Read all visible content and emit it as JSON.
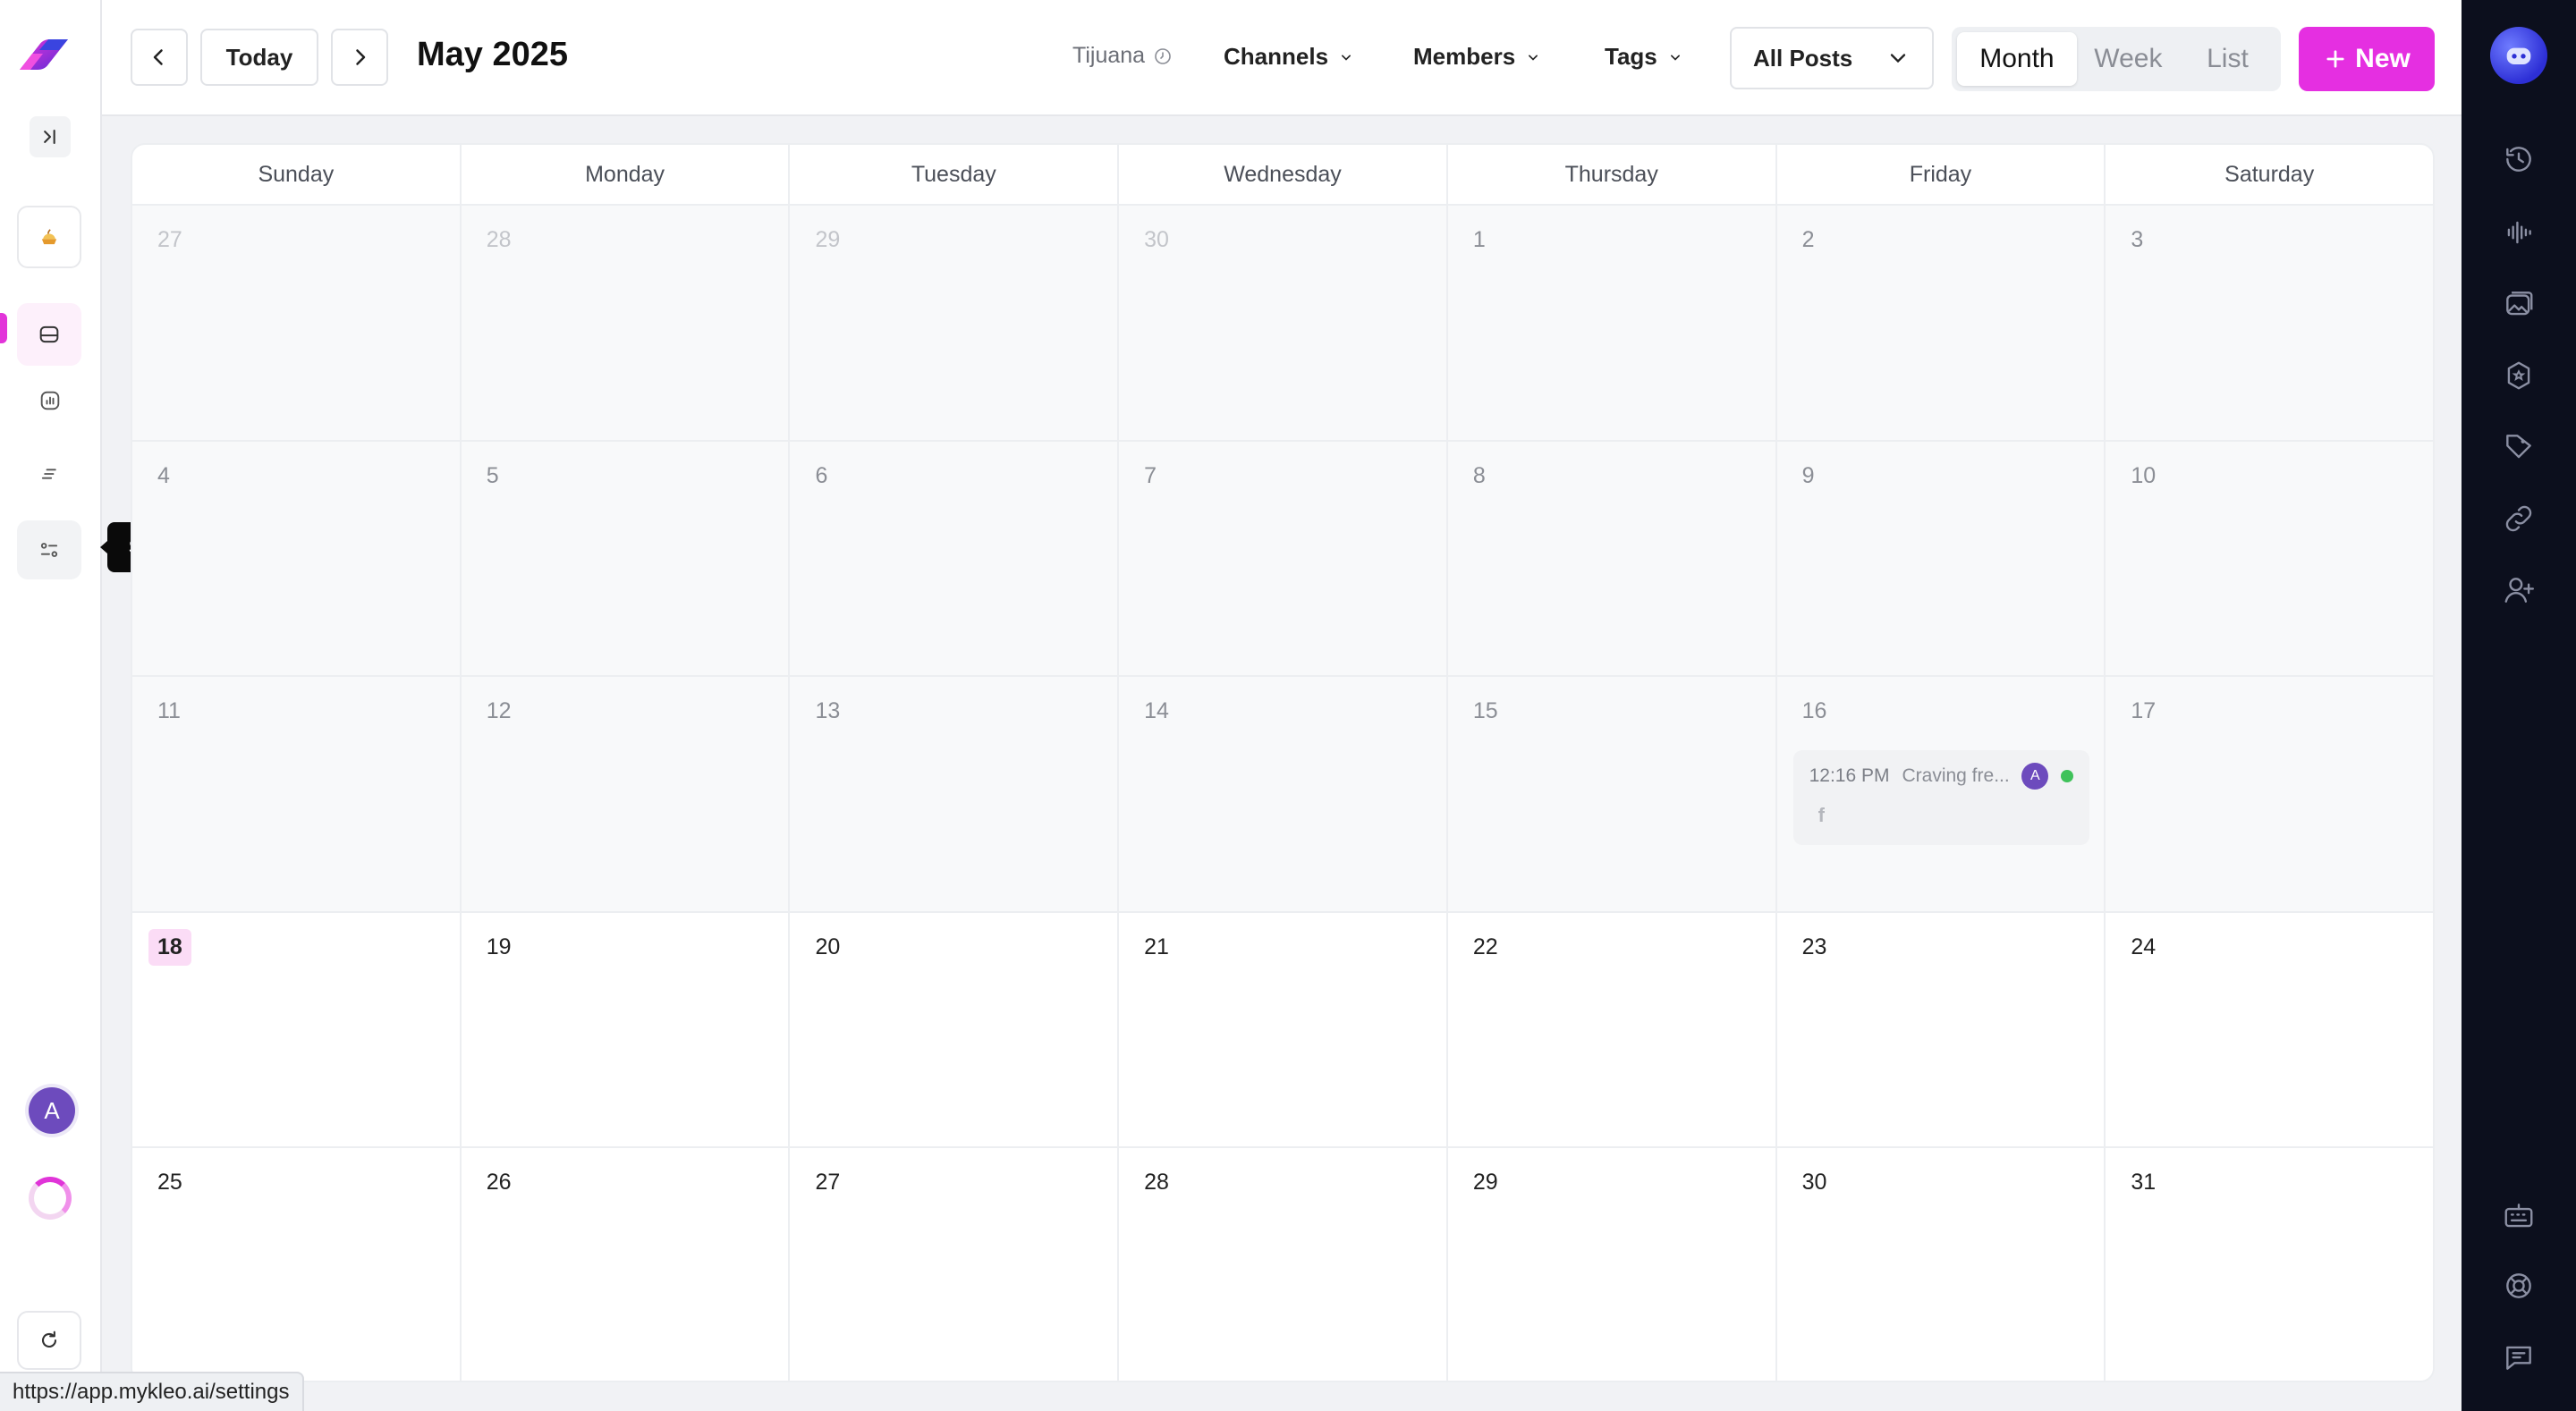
{
  "header": {
    "today_label": "Today",
    "month_title": "May 2025",
    "timezone": "Tijuana",
    "filters": {
      "channels": "Channels",
      "members": "Members",
      "tags": "Tags"
    },
    "posts_select": "All Posts",
    "views": [
      "Month",
      "Week",
      "List"
    ],
    "active_view": "Month",
    "new_label": "New"
  },
  "left_sidebar": {
    "tooltip": "Settings",
    "avatar_letter": "A",
    "accent_color": "#e234d9"
  },
  "status_bar": {
    "url": "https://app.mykleo.ai/settings"
  },
  "calendar": {
    "weekdays": [
      "Sunday",
      "Monday",
      "Tuesday",
      "Wednesday",
      "Thursday",
      "Friday",
      "Saturday"
    ],
    "weeks": [
      [
        "27",
        "28",
        "29",
        "30",
        "1",
        "2",
        "3"
      ],
      [
        "4",
        "5",
        "6",
        "7",
        "8",
        "9",
        "10"
      ],
      [
        "11",
        "12",
        "13",
        "14",
        "15",
        "16",
        "17"
      ],
      [
        "18",
        "19",
        "20",
        "21",
        "22",
        "23",
        "24"
      ],
      [
        "25",
        "26",
        "27",
        "28",
        "29",
        "30",
        "31"
      ]
    ],
    "today": "18",
    "event": {
      "day": "16",
      "time": "12:16 PM",
      "title": "Craving fre...",
      "avatar_letter": "A",
      "channel_icon": "facebook-icon",
      "status_color": "#3fc25a"
    }
  },
  "right_sidebar": {
    "icons": [
      "history-icon",
      "audio-wave-icon",
      "images-icon",
      "brand-kit-icon",
      "tag-icon",
      "link-icon",
      "add-user-icon",
      "keyboard-icon",
      "help-lifebuoy-icon",
      "chat-icon"
    ]
  }
}
